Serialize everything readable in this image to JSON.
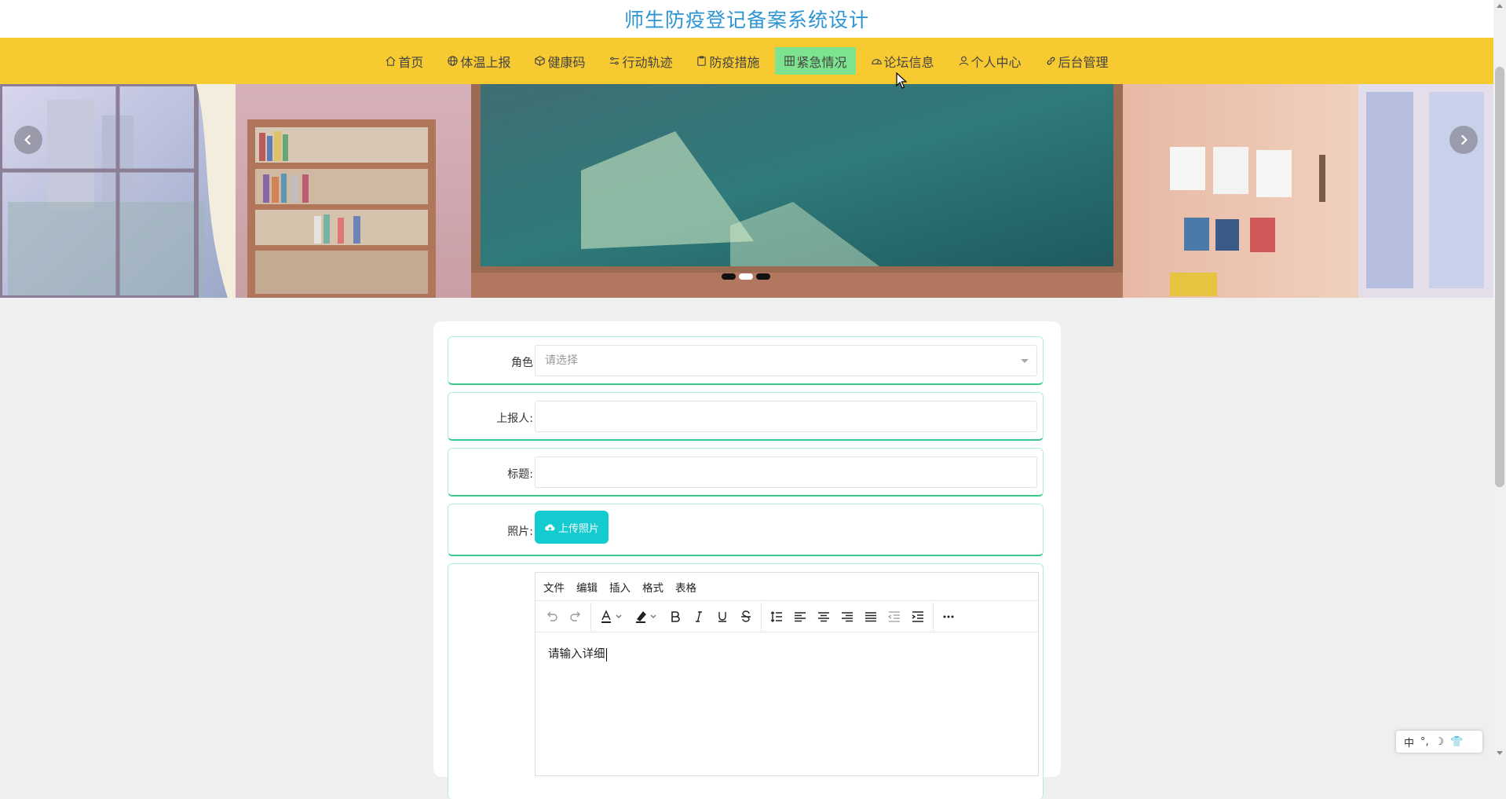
{
  "header": {
    "title": "师生防疫登记备案系统设计"
  },
  "nav": {
    "items": [
      {
        "label": "首页",
        "icon": "home-icon",
        "active": false
      },
      {
        "label": "体温上报",
        "icon": "globe-icon",
        "active": false
      },
      {
        "label": "健康码",
        "icon": "box-icon",
        "active": false
      },
      {
        "label": "行动轨迹",
        "icon": "sliders-icon",
        "active": false
      },
      {
        "label": "防疫措施",
        "icon": "clipboard-icon",
        "active": false
      },
      {
        "label": "紧急情况",
        "icon": "grid-icon",
        "active": true
      },
      {
        "label": "论坛信息",
        "icon": "gauge-icon",
        "active": false
      },
      {
        "label": "个人中心",
        "icon": "user-icon",
        "active": false
      },
      {
        "label": "后台管理",
        "icon": "link-icon",
        "active": false
      }
    ],
    "bg_color": "#f8ca31",
    "active_color": "#7ee38f"
  },
  "carousel": {
    "slide_count": 3,
    "active_index": 1
  },
  "form": {
    "role": {
      "label": "角色",
      "placeholder": "请选择"
    },
    "reporter": {
      "label": "上报人:",
      "value": ""
    },
    "title": {
      "label": "标题:",
      "value": ""
    },
    "photo": {
      "label": "照片:",
      "button": "上传照片"
    },
    "editor": {
      "menus": [
        "文件",
        "编辑",
        "插入",
        "格式",
        "表格"
      ],
      "content": "请输入详细"
    }
  },
  "ime": {
    "mode": "中",
    "symbols": "°,",
    "icons": [
      "moon-icon",
      "shirt-icon"
    ]
  },
  "accent_color": "#14cbd0",
  "title_color": "#2d95d3"
}
